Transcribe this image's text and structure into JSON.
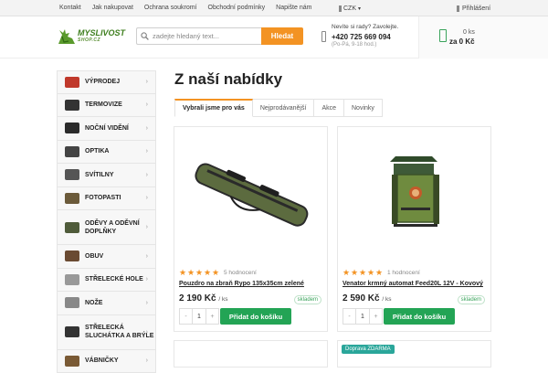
{
  "topbar": {
    "links": [
      "Kontakt",
      "Jak nakupovat",
      "Ochrana soukromí",
      "Obchodní podmínky",
      "Napište nám"
    ],
    "currency": "CZK",
    "login": "Přihlášení"
  },
  "logo": {
    "line1": "MYSLIVOST",
    "line2": "SHOP.CZ"
  },
  "search": {
    "placeholder": "zadejte hledaný text...",
    "button": "Hledat"
  },
  "contact": {
    "question": "Nevíte si rady? Zavolejte.",
    "phone": "+420 725 669 094",
    "hours": "(Po-Pá, 9-18 hod.)"
  },
  "cart": {
    "count": "0 ks",
    "total": "za 0 Kč"
  },
  "sidebar": {
    "items": [
      {
        "label": "VÝPRODEJ",
        "color": "#c0392b"
      },
      {
        "label": "TERMOVIZE",
        "color": "#333"
      },
      {
        "label": "NOČNÍ VIDĚNÍ",
        "color": "#2b2b2b"
      },
      {
        "label": "OPTIKA",
        "color": "#444"
      },
      {
        "label": "SVÍTILNY",
        "color": "#555"
      },
      {
        "label": "FOTOPASTI",
        "color": "#6b5a3a"
      },
      {
        "label": "ODĚVY A ODĚVNÍ DOPLŇKY",
        "color": "#4f5b3a"
      },
      {
        "label": "OBUV",
        "color": "#6a4a32"
      },
      {
        "label": "STŘELECKÉ HOLE",
        "color": "#999"
      },
      {
        "label": "NOŽE",
        "color": "#888"
      },
      {
        "label": "STŘELECKÁ SLUCHÁTKA A BRÝLE",
        "color": "#333"
      },
      {
        "label": "VÁBNIČKY",
        "color": "#7a5a35"
      }
    ]
  },
  "main": {
    "title": "Z naší nabídky",
    "tabs": [
      "Vybrali jsme pro vás",
      "Nejprodávanější",
      "Akce",
      "Novinky"
    ]
  },
  "products": [
    {
      "rating": 5,
      "reviews": "5 hodnocení",
      "name": "Pouzdro na zbraň Rypo 135x35cm zelené",
      "price": "2 190 Kč",
      "unit": "/ ks",
      "stock": "skladem",
      "qty": "1",
      "button": "Přidat do košíku"
    },
    {
      "rating": 5,
      "reviews": "1 hodnocení",
      "name": "Venator krmný automat Feed20L 12V - Kovový",
      "price": "2 590 Kč",
      "unit": "/ ks",
      "stock": "skladem",
      "qty": "1",
      "button": "Přidat do košíku"
    }
  ],
  "next_row": {
    "badge": "Doprava ZDARMA"
  }
}
